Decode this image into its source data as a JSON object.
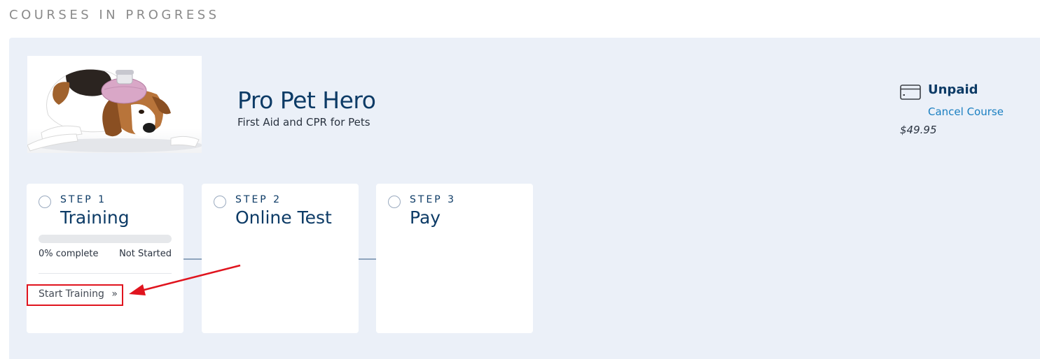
{
  "section": {
    "title": "COURSES IN PROGRESS"
  },
  "course": {
    "image_alt": "beagle-with-ice-pack",
    "title": "Pro Pet Hero",
    "subtitle": "First Aid and CPR for Pets"
  },
  "payment": {
    "status": "Unpaid",
    "cancel_label": "Cancel Course",
    "price": "$49.95",
    "icon": "credit-card-icon"
  },
  "steps": [
    {
      "step_label": "STEP 1",
      "name": "Training",
      "progress_text": "0% complete",
      "progress_fraction": 0,
      "status": "Not Started",
      "action_label": "Start Training",
      "action_glyph": "»"
    },
    {
      "step_label": "STEP 2",
      "name": "Online Test"
    },
    {
      "step_label": "STEP 3",
      "name": "Pay"
    }
  ],
  "colors": {
    "accent": "#0d3b66",
    "link": "#1a7fc1",
    "panel_bg": "#ebf0f8",
    "annotation": "#e0141e"
  }
}
